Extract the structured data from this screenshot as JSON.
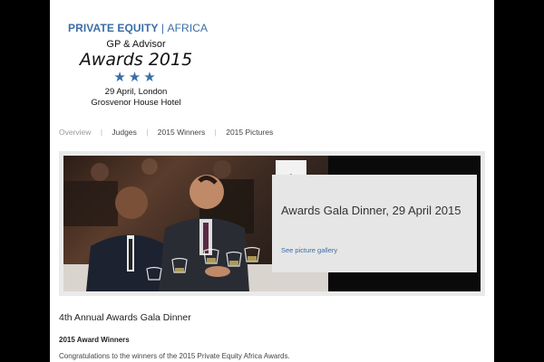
{
  "logo": {
    "brand_part1": "PRIVATE EQUITY",
    "brand_sep": "|",
    "brand_part2": "AFRICA",
    "subtitle": "GP & Advisor",
    "awards": "Awards 2015",
    "stars": "★★★",
    "date": "29 April, London",
    "venue": "Grosvenor House Hotel",
    "colors": {
      "brand": "#3a6ea5"
    }
  },
  "nav": {
    "items": [
      {
        "label": "Overview",
        "active": true
      },
      {
        "label": "Judges",
        "active": false
      },
      {
        "label": "2015 Winners",
        "active": false
      },
      {
        "label": "2015 Pictures",
        "active": false
      }
    ],
    "divider": "|"
  },
  "hero": {
    "title": "Awards Gala Dinner, 29 April 2015",
    "link": "See picture gallery"
  },
  "content": {
    "heading": "4th Annual Awards Gala Dinner",
    "subheading": "2015 Award Winners",
    "paragraph": "Congratulations to the winners of the 2015 Private Equity Africa Awards."
  }
}
